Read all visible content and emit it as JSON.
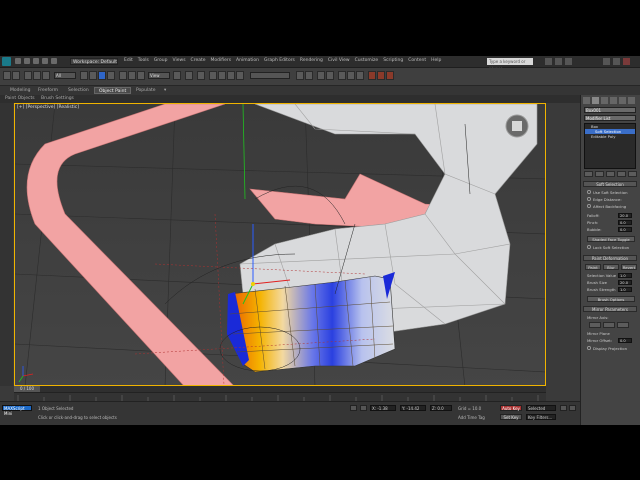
{
  "window": {
    "workspace": "Workspace: Default",
    "search_placeholder": "Type a keyword or phrase"
  },
  "menus": [
    "Edit",
    "Tools",
    "Group",
    "Views",
    "Create",
    "Modifiers",
    "Animation",
    "Graph Editors",
    "Rendering",
    "Civil View",
    "Customize",
    "Scripting",
    "Content",
    "Help"
  ],
  "toolbar": {
    "selection_filter": "All",
    "ref_coord": "View"
  },
  "ribbon": {
    "tabs": [
      "Modeling",
      "Freeform",
      "Selection",
      "Object Paint",
      "Populate"
    ],
    "active_tab": "Object Paint",
    "sub_items": [
      "Paint Objects",
      "Brush Settings"
    ]
  },
  "viewport": {
    "label": "[+] [Perspective] [Realistic]"
  },
  "command_panel": {
    "name_field": "Box001",
    "modifier_list": "Modifier List",
    "stack": [
      {
        "label": "Box",
        "selected": false,
        "sub": false
      },
      {
        "label": "Soft Selection",
        "selected": true,
        "sub": true
      },
      {
        "label": "Editable Poly",
        "selected": false,
        "sub": false
      }
    ],
    "rollouts": {
      "soft_selection": "Soft Selection",
      "paint_deformation": "Paint Deformation",
      "mirror": "Mirror Parameters"
    },
    "soft": {
      "use_soft": "Use Soft Selection",
      "edge_dist": "Edge Distance:",
      "affect_back": "Affect Backfacing",
      "falloff_label": "Falloff:",
      "falloff_val": "20.0",
      "pinch_label": "Pinch:",
      "pinch_val": "0.0",
      "bubble_label": "Bubble:",
      "bubble_val": "0.0",
      "shaded_face": "Shaded Face Toggle",
      "lock_soft": "Lock Soft Selection"
    },
    "paint": {
      "paint": "Paint",
      "blur": "Blur",
      "revert": "Revert",
      "value_label": "Selection Value",
      "value": "1.0",
      "brush_size_label": "Brush Size",
      "brush_size": "20.0",
      "brush_strength_label": "Brush Strength",
      "brush_strength": "1.0",
      "brush_options": "Brush Options"
    },
    "mirror": {
      "axis_label": "Mirror Axis:",
      "mirror_plane": "Mirror Plane",
      "mirror_offset_label": "Mirror Offset:",
      "mirror_offset": "0.0",
      "display_faces": "Display Projection"
    }
  },
  "timeline": {
    "frame": "0 / 100"
  },
  "status": {
    "objects": "1 Object Selected",
    "prompt": "Click or click-and-drag to select objects",
    "x": "X: -1.38",
    "y": "Y: -14.42",
    "z": "Z: 0.0",
    "grid": "Grid = 10.0",
    "autokey": "Auto Key",
    "selected": "Selected",
    "setkey": "Set Key",
    "keyfilters": "Key Filters...",
    "add_time_tag": "Add Time Tag",
    "maxscript": "MAXScript Mini"
  },
  "colors": {
    "viewport_bg": "#3d3d3d",
    "selection_orange": "#f08a00",
    "selection_blue": "#1a2ad8",
    "arrow_pink": "#f2a3a3",
    "mesh_light": "#d9dadc",
    "active_border": "#f0b400"
  }
}
